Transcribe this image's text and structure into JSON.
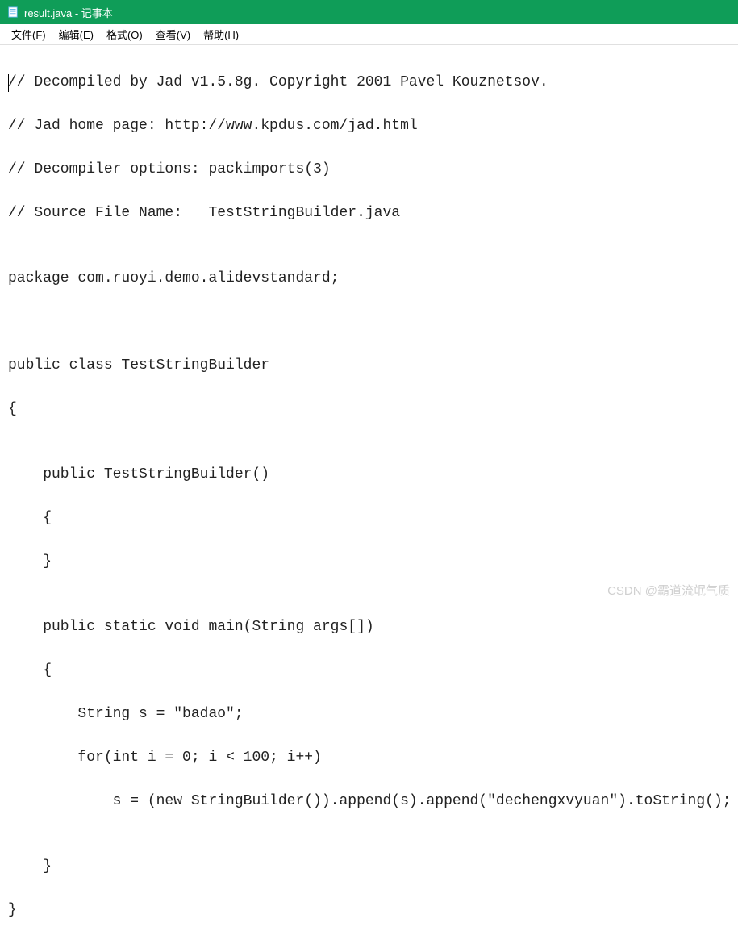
{
  "window": {
    "title": "result.java - 记事本"
  },
  "menu": {
    "file": "文件(F)",
    "edit": "编辑(E)",
    "format": "格式(O)",
    "view": "查看(V)",
    "help": "帮助(H)"
  },
  "code": {
    "line1": "// Decompiled by Jad v1.5.8g. Copyright 2001 Pavel Kouznetsov.",
    "line2": "// Jad home page: http://www.kpdus.com/jad.html",
    "line3": "// Decompiler options: packimports(3) ",
    "line4": "// Source File Name:   TestStringBuilder.java",
    "line5": "",
    "line6": "package com.ruoyi.demo.alidevstandard;",
    "line7": "",
    "line8": "",
    "line9": "public class TestStringBuilder",
    "line10": "{",
    "line11": "",
    "line12": "    public TestStringBuilder()",
    "line13": "    {",
    "line14": "    }",
    "line15": "",
    "line16": "    public static void main(String args[])",
    "line17": "    {",
    "line18": "        String s = \"badao\";",
    "line19": "        for(int i = 0; i < 100; i++)",
    "line20": "            s = (new StringBuilder()).append(s).append(\"dechengxvyuan\").toString();",
    "line21": "",
    "line22": "    }",
    "line23": "}"
  },
  "watermark": {
    "text": "CSDN @霸道流氓气质"
  }
}
